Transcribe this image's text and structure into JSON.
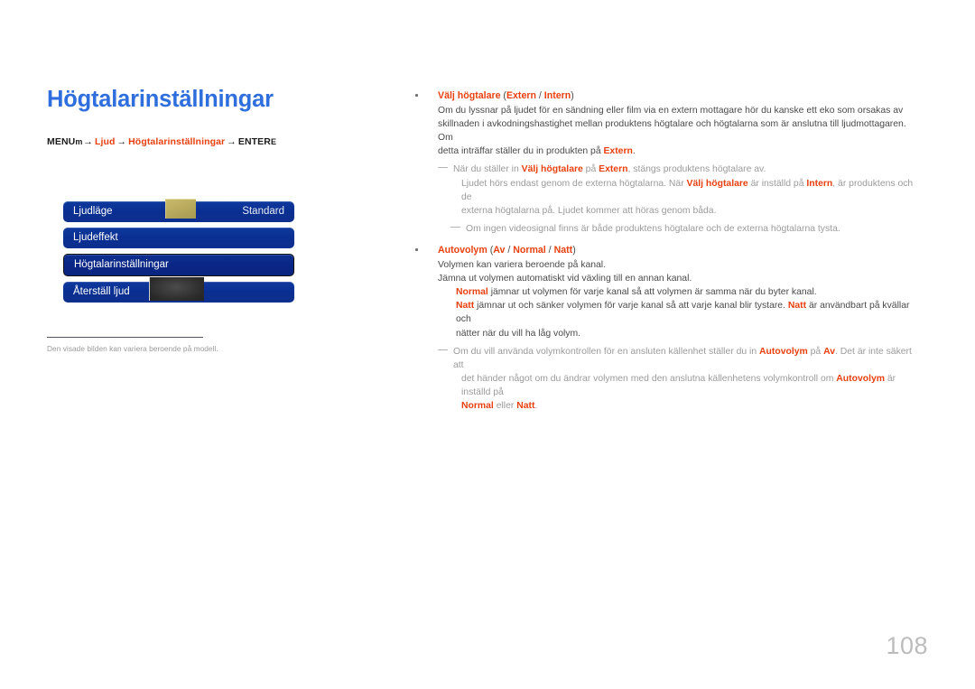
{
  "page": {
    "title": "Högtalarinställningar",
    "number": "108"
  },
  "breadcrumb": {
    "menu_label": "MENU",
    "menu_glyph": "m",
    "arrow1": "→",
    "step1": "Ljud",
    "arrow2": "→",
    "step2": "Högtalarinställningar",
    "arrow3": "→",
    "enter_label": "ENTER",
    "enter_glyph": "E"
  },
  "osd": {
    "rows": [
      {
        "label": "Ljudläge",
        "value": "Standard",
        "selected": false
      },
      {
        "label": "Ljudeffekt",
        "value": "",
        "selected": false
      },
      {
        "label": "Högtalarinställningar",
        "value": "",
        "selected": true
      },
      {
        "label": "Återställ ljud",
        "value": "",
        "selected": false
      }
    ],
    "caption": "Den visade bilden kan variera beroende på modell."
  },
  "content": {
    "section1": {
      "heading_term": "Välj högtalare",
      "heading_open": " (",
      "heading_opt1": "Extern",
      "heading_sep": " / ",
      "heading_opt2": "Intern",
      "heading_close": ")",
      "body_1": "Om du lyssnar på ljudet för en sändning eller film via en extern mottagare hör du kanske ett eko som orsakas av",
      "body_2": "skillnaden i avkodningshastighet mellan produktens högtalare och högtalarna som är anslutna till ljudmottagaren. Om",
      "body_3a": "detta inträffar ställer du in produkten på ",
      "body_3b": "Extern",
      "body_3c": ".",
      "note_a1": "När du ställer in ",
      "note_a2": "Välj högtalare",
      "note_a3": " på ",
      "note_a4": "Extern",
      "note_a5": ", stängs produktens högtalare av.",
      "note_b1": "Ljudet hörs endast genom de externa högtalarna. När ",
      "note_b2": "Välj högtalare",
      "note_b3": " är inställd på ",
      "note_b4": "Intern",
      "note_b5": ", är produktens och de",
      "note_c": "externa högtalarna på. Ljudet kommer att höras genom båda.",
      "note_d": "Om ingen videosignal finns är både produktens högtalare och de externa högtalarna tysta."
    },
    "section2": {
      "heading_term": "Autovolym",
      "heading_open": " (",
      "heading_opt1": "Av",
      "heading_sep1": " / ",
      "heading_opt2": "Normal",
      "heading_sep2": " / ",
      "heading_opt3": "Natt",
      "heading_close": ")",
      "body_1": "Volymen kan variera beroende på kanal.",
      "body_2": "Jämna ut volymen automatiskt vid växling till en annan kanal.",
      "sub_1a": "Normal",
      "sub_1b": " jämnar ut volymen för varje kanal så att volymen är samma när du byter kanal.",
      "sub_2a": "Natt",
      "sub_2b": " jämnar ut och sänker volymen för varje kanal så att varje kanal blir tystare. ",
      "sub_2c": "Natt",
      "sub_2d": " är användbart på kvällar och",
      "sub_3": "nätter när du vill ha låg volym.",
      "note_a1": "Om du vill använda volymkontrollen för en ansluten källenhet ställer du in ",
      "note_a2": "Autovolym",
      "note_a3": " på ",
      "note_a4": "Av",
      "note_a5": ". Det är inte säkert att",
      "note_b1": "det händer något om du ändrar volymen med den anslutna källenhetens volymkontroll om ",
      "note_b2": "Autovolym",
      "note_b3": " är inställd på",
      "note_c1": "Normal",
      "note_c2": " eller ",
      "note_c3": "Natt",
      "note_c4": "."
    }
  }
}
